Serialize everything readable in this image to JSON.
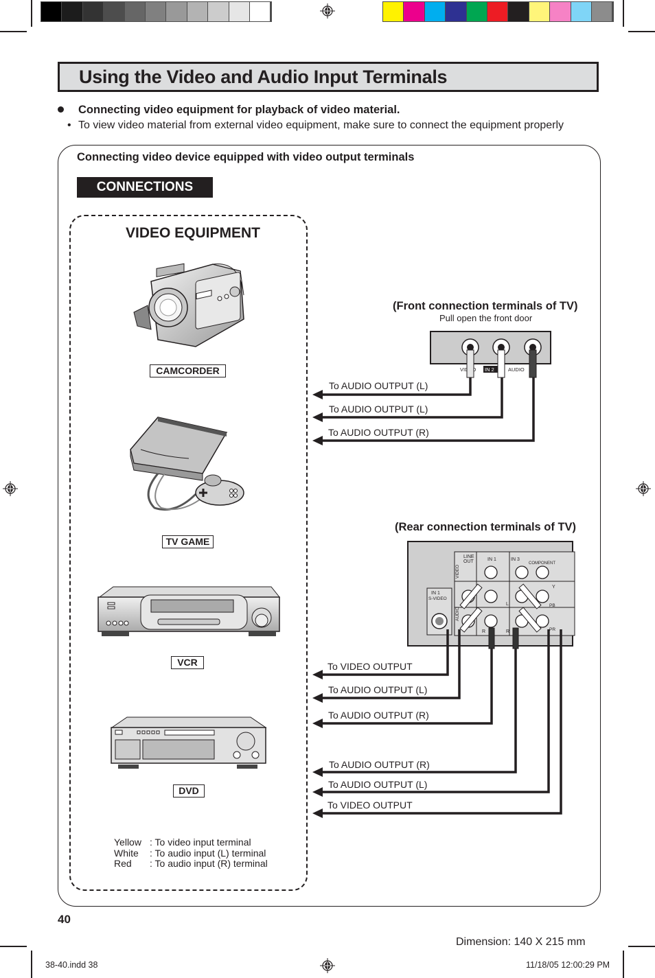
{
  "color_bars": {
    "grayscale": [
      "#000000",
      "#1c1c1c",
      "#333333",
      "#4d4d4d",
      "#666666",
      "#808080",
      "#999999",
      "#b3b3b3",
      "#cccccc",
      "#e6e6e6",
      "#ffffff"
    ],
    "process": [
      "#fff200",
      "#ec008c",
      "#00aeef",
      "#2e3192",
      "#00a651",
      "#ed1c24",
      "#231f20",
      "#fff57a",
      "#f682c5",
      "#7fd5f7",
      "#8c8c8c"
    ]
  },
  "header": {
    "title": "Using the Video and Audio Input Terminals",
    "heading": "Connecting video equipment for playback of video material.",
    "note": "To view video material from external video equipment, make sure to connect the equipment properly"
  },
  "panel": {
    "subtitle": "Connecting video device equipped with video output terminals",
    "connections_label": "CONNECTIONS",
    "equipment_title": "VIDEO EQUIPMENT",
    "devices": [
      {
        "label": "CAMCORDER",
        "icon": "camcorder-icon"
      },
      {
        "label": "TV GAME",
        "icon": "game-console-icon"
      },
      {
        "label": "VCR",
        "icon": "vcr-icon"
      },
      {
        "label": "DVD",
        "icon": "dvd-player-icon"
      }
    ],
    "front": {
      "title": "(Front connection terminals of TV)",
      "subtitle": "Pull open the front door",
      "jack_labels": {
        "video": "VIDEO",
        "input": "IN 2",
        "audio": "AUDIO"
      },
      "cables": [
        "To AUDIO OUTPUT (L)",
        "To AUDIO OUTPUT (L)",
        "To AUDIO OUTPUT (R)"
      ]
    },
    "rear": {
      "title": "(Rear connection terminals of TV)",
      "jack_labels": {
        "line_out": "LINE OUT",
        "in1": "IN 1",
        "in3": "IN 3",
        "component": "COMPONENT",
        "video": "VIDEO",
        "audio": "AUDIO",
        "svideo": "IN 1 S-VIDEO",
        "l": "L",
        "r": "R",
        "y": "Y",
        "pb": "PB",
        "pr": "PR"
      },
      "cables_in1": [
        "To VIDEO OUTPUT",
        "To AUDIO OUTPUT (L)",
        "To AUDIO OUTPUT (R)"
      ],
      "cables_in3": [
        "To AUDIO OUTPUT (R)",
        "To AUDIO OUTPUT (L)",
        "To VIDEO OUTPUT"
      ]
    },
    "legend": [
      {
        "color": "Yellow",
        "desc": ": To video input terminal"
      },
      {
        "color": "White",
        "desc": ": To audio input (L) terminal"
      },
      {
        "color": "Red",
        "desc": ": To audio input (R) terminal"
      }
    ]
  },
  "footer": {
    "page_number": "40",
    "dimension": "Dimension: 140  X 215 mm",
    "file": "38-40.indd   38",
    "timestamp": "11/18/05   12:00:29 PM"
  }
}
